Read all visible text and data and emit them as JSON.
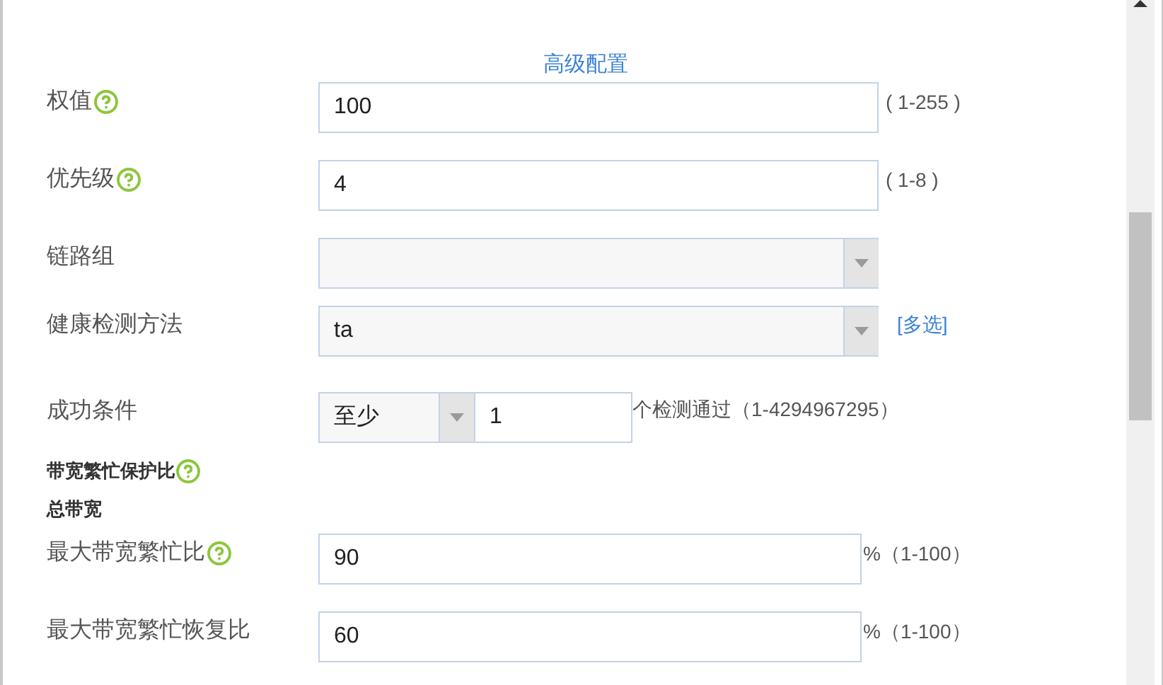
{
  "section_title": "高级配置",
  "rows": [
    {
      "kind": "text",
      "label": "权值",
      "help": true,
      "value": "100",
      "hint": "( 1-255 )",
      "narrow": false
    },
    {
      "kind": "text",
      "label": "优先级",
      "help": true,
      "value": "4",
      "hint": "( 1-8 )",
      "narrow": false
    },
    {
      "kind": "select",
      "label": "链路组",
      "help": false
    },
    {
      "kind": "select",
      "label": "健康检测方法",
      "help": false,
      "value": "ta",
      "link": "[多选]"
    },
    {
      "kind": "condition",
      "label": "成功条件",
      "help": false,
      "select_value": "至少",
      "value": "1",
      "hint": "个检测通过（1-4294967295）"
    },
    {
      "kind": "heading",
      "label": "带宽繁忙保护比",
      "help": true
    },
    {
      "kind": "heading",
      "label": "总带宽",
      "help": false
    },
    {
      "kind": "text",
      "label": "最大带宽繁忙比",
      "help": true,
      "value": "90",
      "hint": "%（1-100）",
      "narrow": true
    },
    {
      "kind": "text",
      "label": "最大带宽繁忙恢复比",
      "help": false,
      "value": "60",
      "hint": "%（1-100）",
      "narrow": true
    }
  ]
}
